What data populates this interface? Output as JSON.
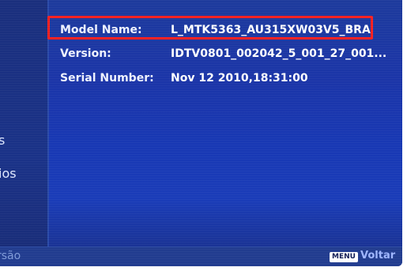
{
  "info": {
    "model_name_label": "Model Name:",
    "model_name_value": "L_MTK5363_AU315XW03V5_BRA",
    "version_label": "Version:",
    "version_value": "IDTV0801_002042_5_001_27_001...",
    "serial_label": "Serial Number:",
    "serial_value": "Nov 12 2010,18:31:00"
  },
  "left_menu": {
    "items": [
      "s",
      "ios"
    ]
  },
  "footer": {
    "left_text": "rsão",
    "menu_key": "MENU",
    "back_label": "Voltar"
  },
  "colors": {
    "background": "#1a38b0",
    "highlight_border": "#ff2020",
    "text": "#ffffff"
  }
}
